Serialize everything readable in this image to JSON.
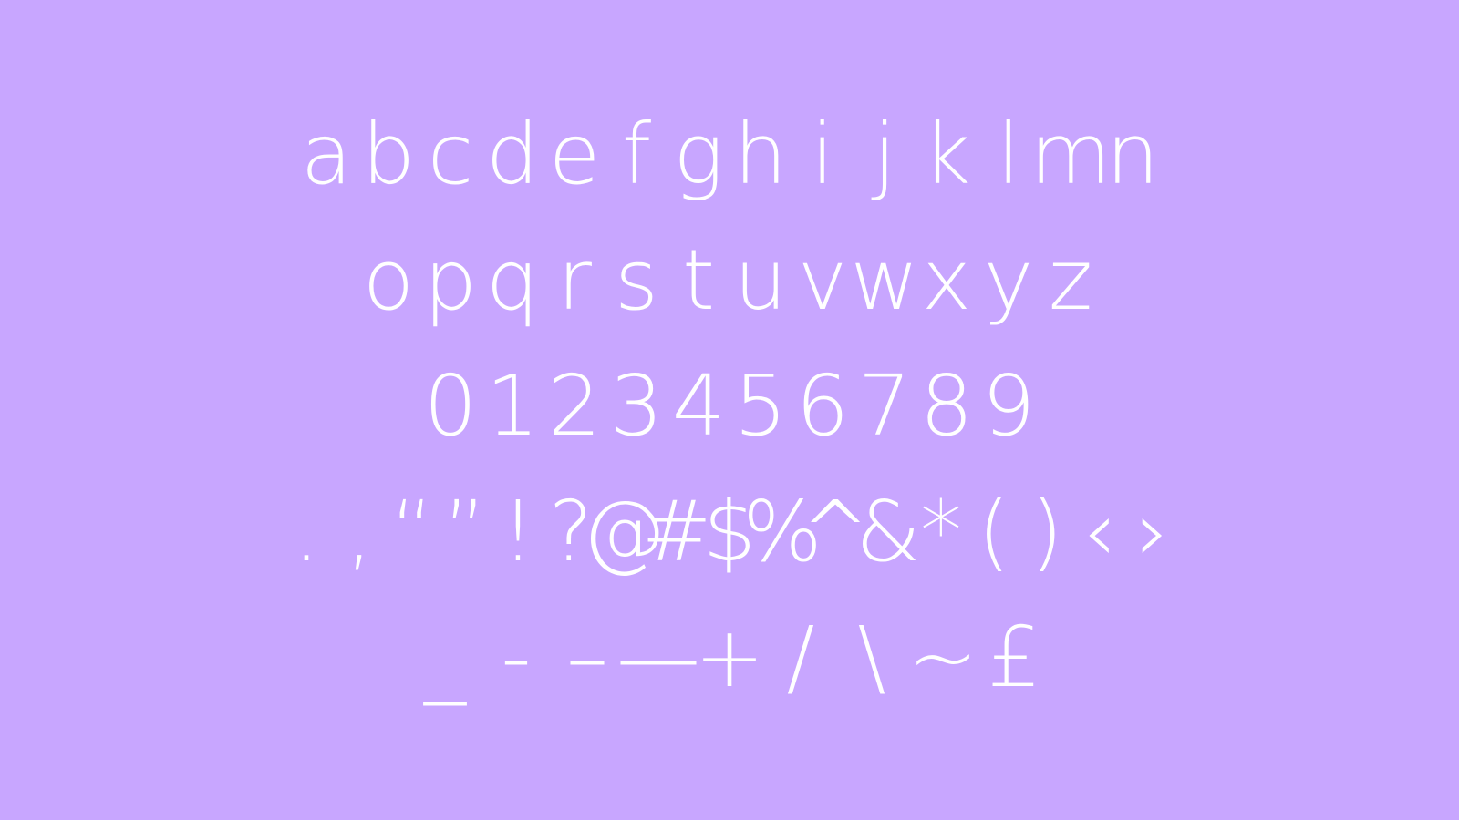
{
  "specimen": {
    "background_color": "#c8a6ff",
    "glyph_color": "#ffffff",
    "rows": [
      [
        "a",
        "b",
        "c",
        "d",
        "e",
        "f",
        "g",
        "h",
        "i",
        "j",
        "k",
        "l",
        "m",
        "n"
      ],
      [
        "o",
        "p",
        "q",
        "r",
        "s",
        "t",
        "u",
        "v",
        "w",
        "x",
        "y",
        "z"
      ],
      [
        "0",
        "1",
        "2",
        "3",
        "4",
        "5",
        "6",
        "7",
        "8",
        "9"
      ],
      [
        ".",
        ",",
        "“",
        "”",
        "!",
        "?",
        "@",
        "#",
        "$",
        "%",
        "^",
        "&",
        "*",
        "(",
        ")",
        "‹",
        "›"
      ],
      [
        "_",
        "-",
        "–",
        "—",
        "+",
        "/",
        "\\",
        "~",
        "£"
      ]
    ]
  }
}
